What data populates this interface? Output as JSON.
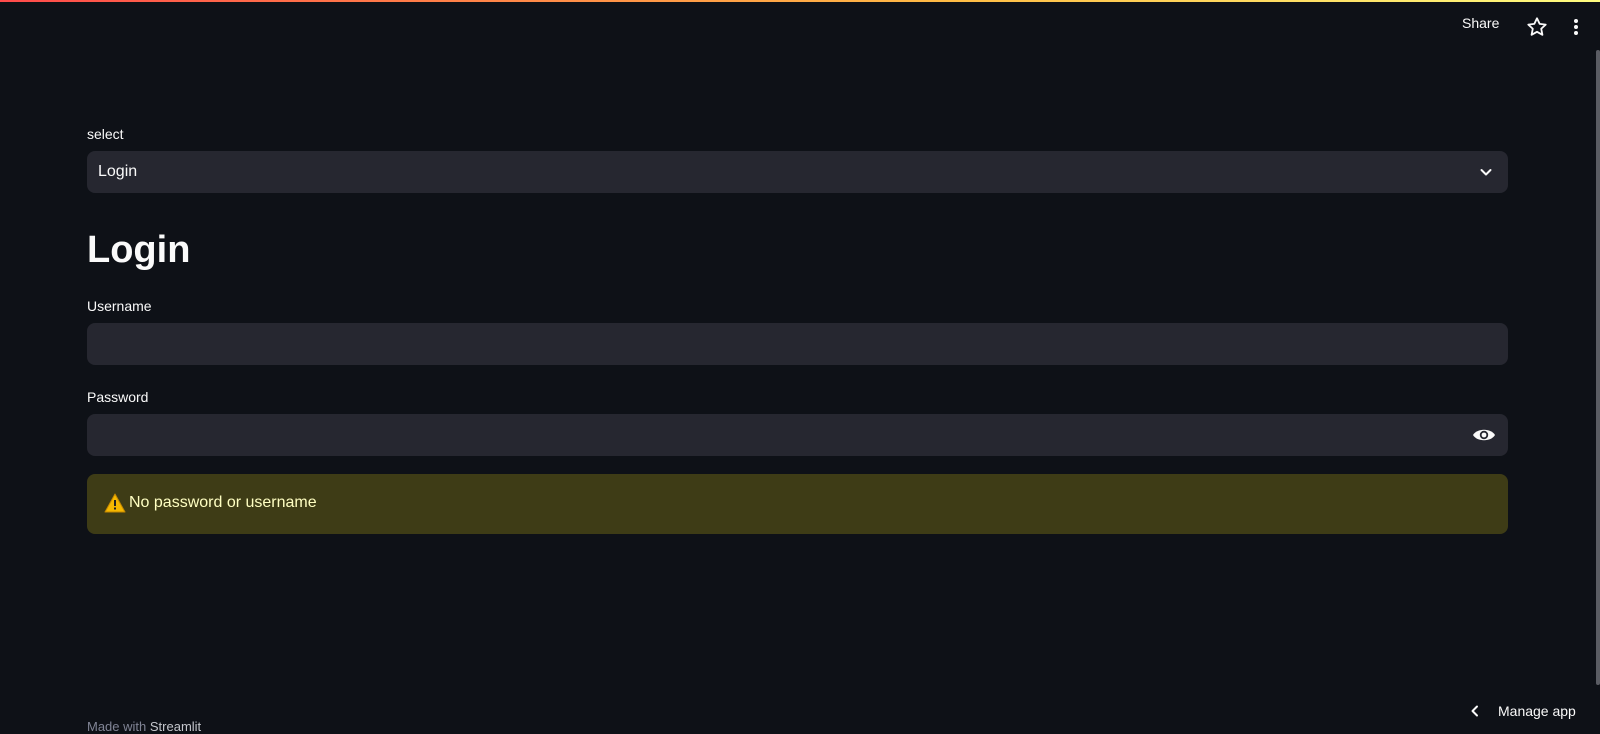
{
  "header": {
    "share_label": "Share"
  },
  "main": {
    "select_label": "select",
    "select_value": "Login",
    "heading": "Login",
    "username_label": "Username",
    "username_value": "",
    "password_label": "Password",
    "password_value": "",
    "warning_text": "No password or username"
  },
  "footer": {
    "made_with": "Made with",
    "brand": "Streamlit"
  },
  "manage_app": {
    "label": "Manage app"
  },
  "colors": {
    "background": "#0e1117",
    "input_bg": "#262730",
    "warning_bg": "#3e3c16",
    "warning_text": "#ffffc2"
  },
  "icons": {
    "star": "star-icon",
    "menu": "kebab-menu-icon",
    "chevron": "chevron-down-icon",
    "eye": "eye-icon",
    "warning": "warning-icon",
    "manage_chevron": "chevron-left-icon"
  }
}
